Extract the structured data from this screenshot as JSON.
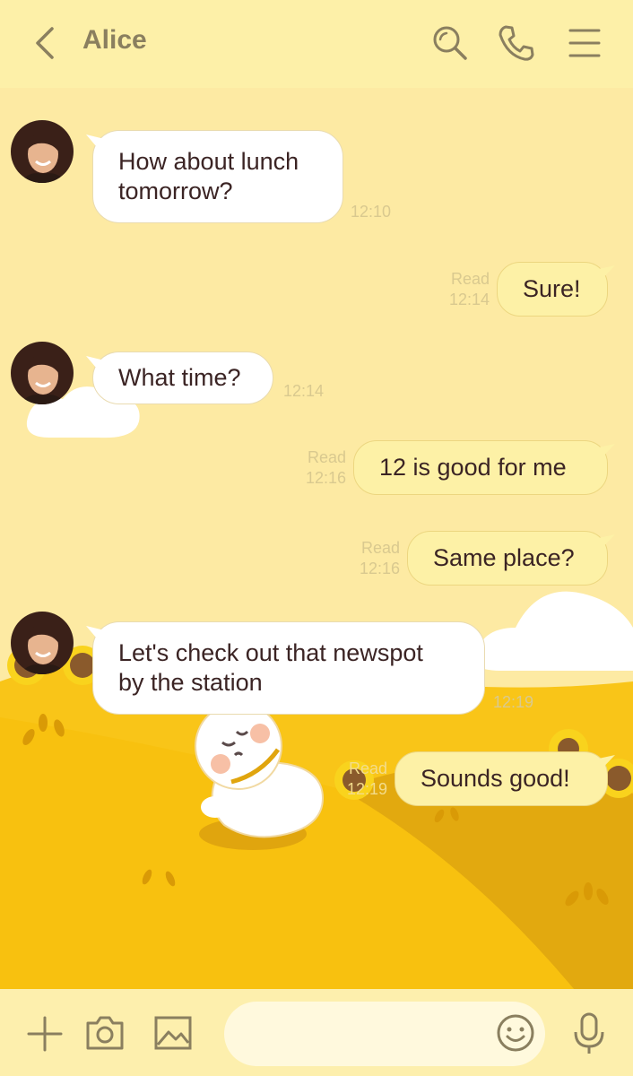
{
  "header": {
    "back_icon": "chevron-left-icon",
    "title": "Alice",
    "icons": [
      "search-icon",
      "phone-icon",
      "menu-icon"
    ]
  },
  "messages": [
    {
      "direction": "incoming",
      "text_lines": [
        "How about lunch",
        "tomorrow?"
      ],
      "time": "12:10"
    },
    {
      "direction": "outgoing",
      "text": "Sure!",
      "read": "Read",
      "time": "12:14"
    },
    {
      "direction": "incoming",
      "text": "What time?",
      "time": "12:14"
    },
    {
      "direction": "outgoing",
      "text": "12 is good for me",
      "read": "Read",
      "time": "12:16"
    },
    {
      "direction": "outgoing",
      "text": "Same place?",
      "read": "Read",
      "time": "12:16"
    },
    {
      "direction": "incoming",
      "text_lines": [
        "Let's check out that newspot",
        "by the station"
      ],
      "time": "12:19"
    },
    {
      "direction": "outgoing",
      "text": "Sounds good!",
      "read": "Read",
      "time": "12:19"
    }
  ],
  "input_bar": {
    "icons": [
      "plus-icon",
      "camera-icon",
      "image-icon",
      "emoji-icon",
      "microphone-icon"
    ],
    "message_value": ""
  },
  "colors": {
    "background": "#fdeaa3",
    "header": "#fdf0a8",
    "hill": "#f7c21d",
    "outgoing_bubble": "#fdf1a6",
    "incoming_bubble": "#ffffff",
    "text": "#3b2424"
  }
}
